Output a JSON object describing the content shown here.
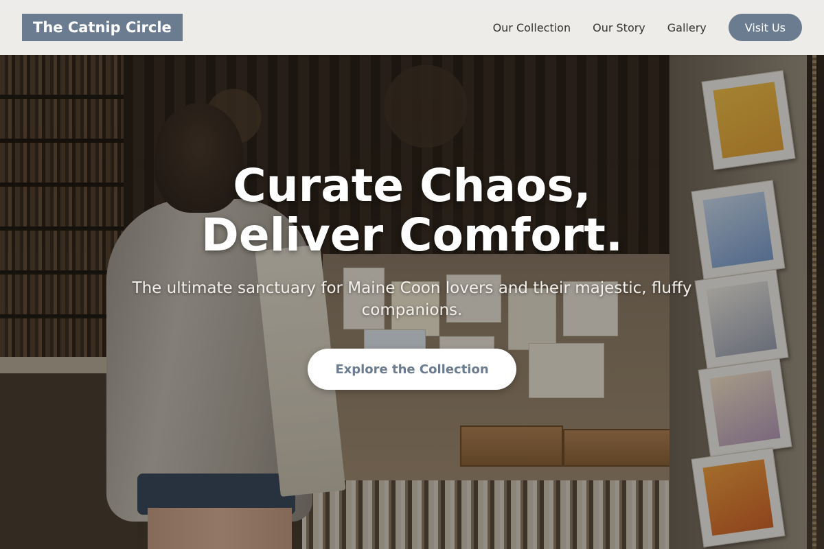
{
  "header": {
    "brand": "The Catnip Circle",
    "nav": [
      {
        "label": "Our Collection"
      },
      {
        "label": "Our Story"
      },
      {
        "label": "Gallery"
      }
    ],
    "cta_label": "Visit Us"
  },
  "hero": {
    "title_line1": "Curate Chaos,",
    "title_line2": "Deliver Comfort.",
    "subtitle": "The ultimate sanctuary for Maine Coon lovers and their majestic, fluffy companions.",
    "button_label": "Explore the Collection",
    "background": "photo-of-shop-interior-with-postcards"
  },
  "colors": {
    "accent": "#6b7b90",
    "header_bg": "#f6f5f3",
    "nav_text": "#333333",
    "hero_text": "#ffffff"
  }
}
